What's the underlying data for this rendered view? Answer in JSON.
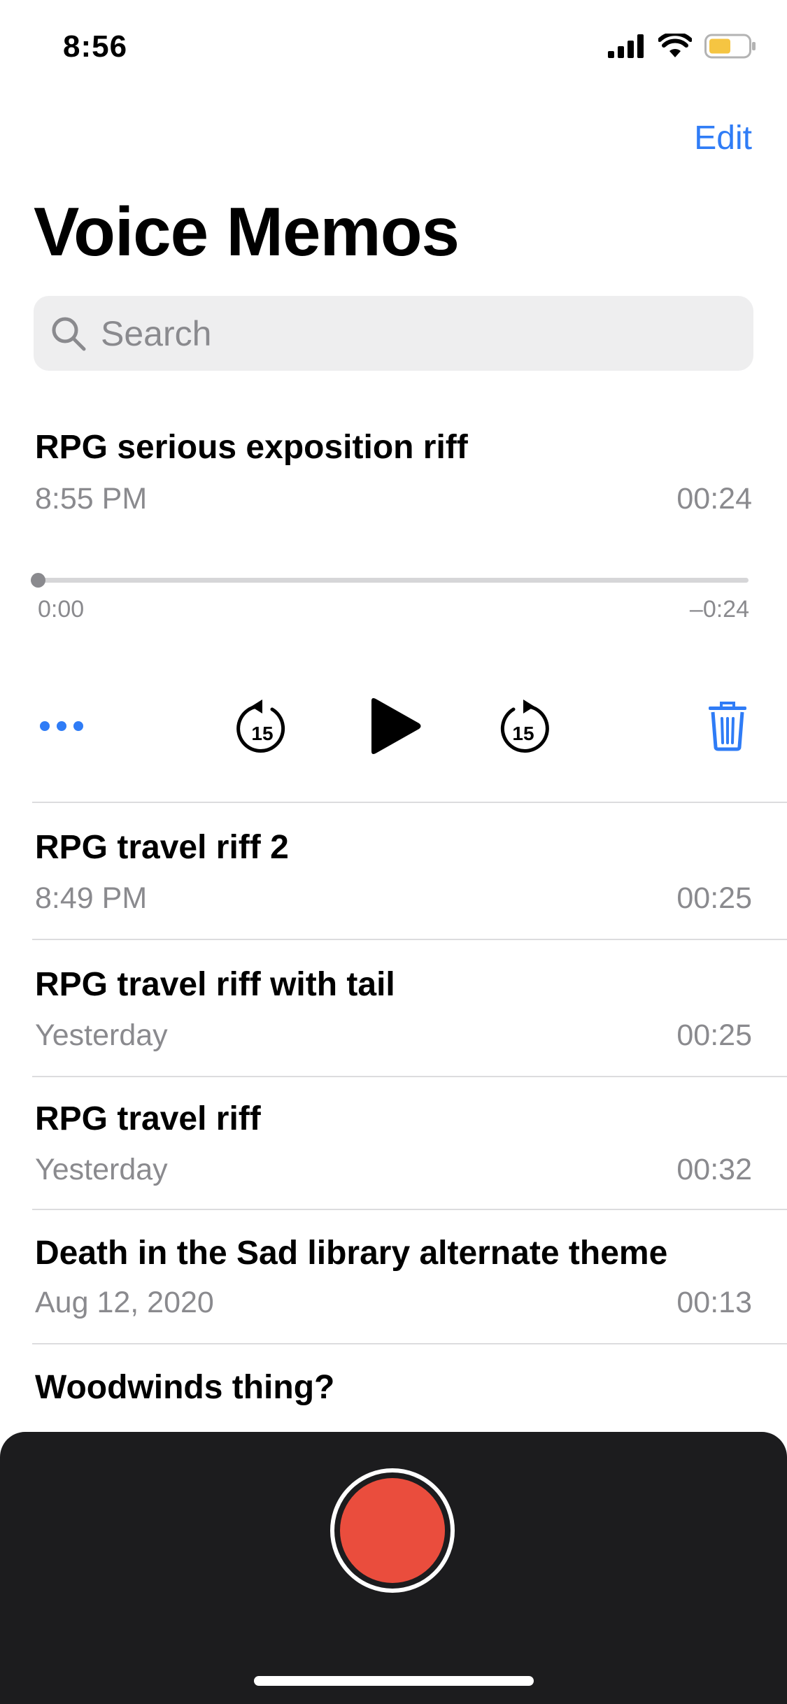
{
  "status_bar": {
    "time": "8:56",
    "icons": [
      "cellular-signal-icon",
      "wifi-icon",
      "battery-icon"
    ],
    "battery_color": "#f5c542"
  },
  "nav": {
    "edit_label": "Edit",
    "title": "Voice Memos"
  },
  "search": {
    "placeholder": "Search"
  },
  "expanded_memo": {
    "title": "RPG serious exposition riff",
    "date": "8:55 PM",
    "duration": "00:24",
    "elapsed": "0:00",
    "remaining": "–0:24",
    "progress": 0,
    "controls": [
      "more-icon",
      "skip-back-15-icon",
      "play-icon",
      "skip-forward-15-icon",
      "trash-icon"
    ],
    "skip_seconds": "15"
  },
  "memos": [
    {
      "title": "RPG travel riff 2",
      "date": "8:49 PM",
      "duration": "00:25"
    },
    {
      "title": "RPG travel riff with tail",
      "date": "Yesterday",
      "duration": "00:25"
    },
    {
      "title": "RPG travel riff",
      "date": "Yesterday",
      "duration": "00:32"
    },
    {
      "title": "Death in the Sad library alternate theme",
      "date": "Aug 12, 2020",
      "duration": "00:13"
    },
    {
      "title": "Woodwinds thing?",
      "date": "",
      "duration": ""
    }
  ],
  "record": {
    "button_icon": "record-icon",
    "color": "#ea4d3d"
  },
  "colors": {
    "accent": "#2f7cf6",
    "secondary_text": "#8a8a8e",
    "panel": "#1c1c1e"
  }
}
